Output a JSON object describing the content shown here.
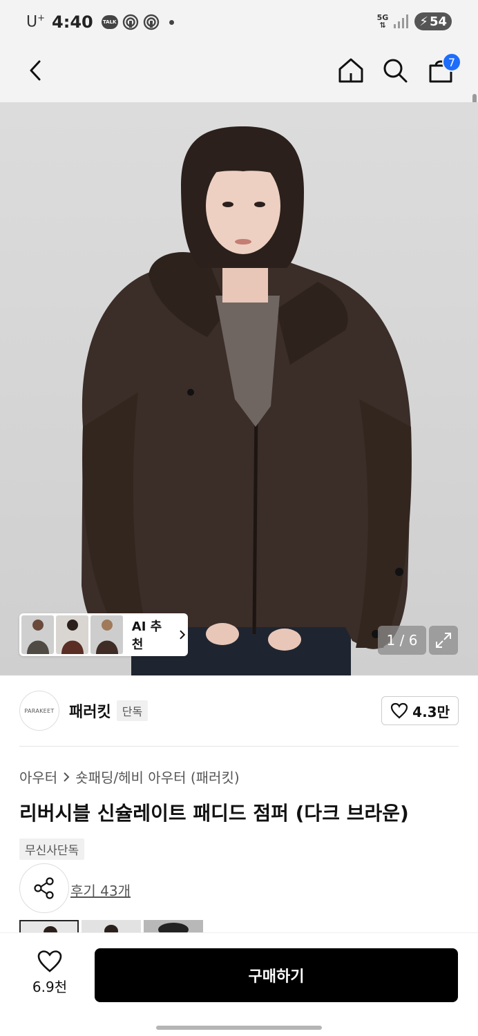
{
  "status_bar": {
    "carrier": "U",
    "carrier_sup": "+",
    "time": "4:40",
    "talk": "TALK",
    "network": "5G",
    "battery": "54"
  },
  "nav": {
    "cart_count": "7"
  },
  "gallery": {
    "ai_label": "AI 추천",
    "counter": "1 / 6"
  },
  "brand": {
    "logo_text": "PARAKEET",
    "name": "패러킷",
    "tag": "단독",
    "likes": "4.3만"
  },
  "product": {
    "breadcrumb": [
      "아우터",
      "숏패딩/헤비 아우터 (패러킷)"
    ],
    "title": "리버시블 신슐레이트 패디드 점퍼 (다크 브라운)",
    "exclusive_tag": "무신사단독",
    "reviews": "후기 43개"
  },
  "bottom_bar": {
    "wish_count": "6.9천",
    "buy_label": "구매하기"
  },
  "icons": {
    "back": "chevron-left-icon",
    "home": "home-icon",
    "search": "search-icon",
    "cart": "shopping-bag-icon",
    "expand": "expand-icon",
    "share": "share-icon",
    "heart": "heart-icon"
  },
  "colors": {
    "cart_badge": "#1d6dfa",
    "buy_button": "#000000",
    "jacket": "#3b2d28"
  }
}
